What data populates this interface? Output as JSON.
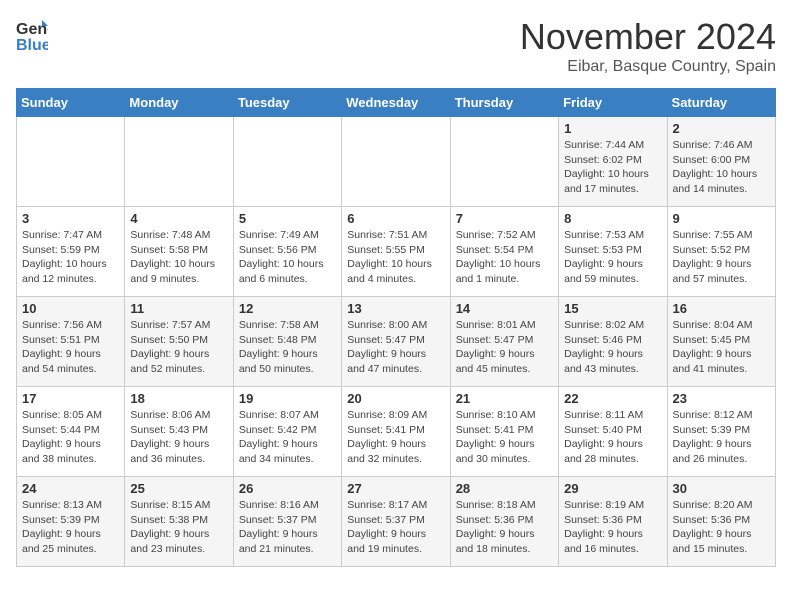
{
  "logo": {
    "general": "General",
    "blue": "Blue"
  },
  "title": "November 2024",
  "location": "Eibar, Basque Country, Spain",
  "days_header": [
    "Sunday",
    "Monday",
    "Tuesday",
    "Wednesday",
    "Thursday",
    "Friday",
    "Saturday"
  ],
  "weeks": [
    [
      {
        "day": "",
        "info": ""
      },
      {
        "day": "",
        "info": ""
      },
      {
        "day": "",
        "info": ""
      },
      {
        "day": "",
        "info": ""
      },
      {
        "day": "",
        "info": ""
      },
      {
        "day": "1",
        "info": "Sunrise: 7:44 AM\nSunset: 6:02 PM\nDaylight: 10 hours and 17 minutes."
      },
      {
        "day": "2",
        "info": "Sunrise: 7:46 AM\nSunset: 6:00 PM\nDaylight: 10 hours and 14 minutes."
      }
    ],
    [
      {
        "day": "3",
        "info": "Sunrise: 7:47 AM\nSunset: 5:59 PM\nDaylight: 10 hours and 12 minutes."
      },
      {
        "day": "4",
        "info": "Sunrise: 7:48 AM\nSunset: 5:58 PM\nDaylight: 10 hours and 9 minutes."
      },
      {
        "day": "5",
        "info": "Sunrise: 7:49 AM\nSunset: 5:56 PM\nDaylight: 10 hours and 6 minutes."
      },
      {
        "day": "6",
        "info": "Sunrise: 7:51 AM\nSunset: 5:55 PM\nDaylight: 10 hours and 4 minutes."
      },
      {
        "day": "7",
        "info": "Sunrise: 7:52 AM\nSunset: 5:54 PM\nDaylight: 10 hours and 1 minute."
      },
      {
        "day": "8",
        "info": "Sunrise: 7:53 AM\nSunset: 5:53 PM\nDaylight: 9 hours and 59 minutes."
      },
      {
        "day": "9",
        "info": "Sunrise: 7:55 AM\nSunset: 5:52 PM\nDaylight: 9 hours and 57 minutes."
      }
    ],
    [
      {
        "day": "10",
        "info": "Sunrise: 7:56 AM\nSunset: 5:51 PM\nDaylight: 9 hours and 54 minutes."
      },
      {
        "day": "11",
        "info": "Sunrise: 7:57 AM\nSunset: 5:50 PM\nDaylight: 9 hours and 52 minutes."
      },
      {
        "day": "12",
        "info": "Sunrise: 7:58 AM\nSunset: 5:48 PM\nDaylight: 9 hours and 50 minutes."
      },
      {
        "day": "13",
        "info": "Sunrise: 8:00 AM\nSunset: 5:47 PM\nDaylight: 9 hours and 47 minutes."
      },
      {
        "day": "14",
        "info": "Sunrise: 8:01 AM\nSunset: 5:47 PM\nDaylight: 9 hours and 45 minutes."
      },
      {
        "day": "15",
        "info": "Sunrise: 8:02 AM\nSunset: 5:46 PM\nDaylight: 9 hours and 43 minutes."
      },
      {
        "day": "16",
        "info": "Sunrise: 8:04 AM\nSunset: 5:45 PM\nDaylight: 9 hours and 41 minutes."
      }
    ],
    [
      {
        "day": "17",
        "info": "Sunrise: 8:05 AM\nSunset: 5:44 PM\nDaylight: 9 hours and 38 minutes."
      },
      {
        "day": "18",
        "info": "Sunrise: 8:06 AM\nSunset: 5:43 PM\nDaylight: 9 hours and 36 minutes."
      },
      {
        "day": "19",
        "info": "Sunrise: 8:07 AM\nSunset: 5:42 PM\nDaylight: 9 hours and 34 minutes."
      },
      {
        "day": "20",
        "info": "Sunrise: 8:09 AM\nSunset: 5:41 PM\nDaylight: 9 hours and 32 minutes."
      },
      {
        "day": "21",
        "info": "Sunrise: 8:10 AM\nSunset: 5:41 PM\nDaylight: 9 hours and 30 minutes."
      },
      {
        "day": "22",
        "info": "Sunrise: 8:11 AM\nSunset: 5:40 PM\nDaylight: 9 hours and 28 minutes."
      },
      {
        "day": "23",
        "info": "Sunrise: 8:12 AM\nSunset: 5:39 PM\nDaylight: 9 hours and 26 minutes."
      }
    ],
    [
      {
        "day": "24",
        "info": "Sunrise: 8:13 AM\nSunset: 5:39 PM\nDaylight: 9 hours and 25 minutes."
      },
      {
        "day": "25",
        "info": "Sunrise: 8:15 AM\nSunset: 5:38 PM\nDaylight: 9 hours and 23 minutes."
      },
      {
        "day": "26",
        "info": "Sunrise: 8:16 AM\nSunset: 5:37 PM\nDaylight: 9 hours and 21 minutes."
      },
      {
        "day": "27",
        "info": "Sunrise: 8:17 AM\nSunset: 5:37 PM\nDaylight: 9 hours and 19 minutes."
      },
      {
        "day": "28",
        "info": "Sunrise: 8:18 AM\nSunset: 5:36 PM\nDaylight: 9 hours and 18 minutes."
      },
      {
        "day": "29",
        "info": "Sunrise: 8:19 AM\nSunset: 5:36 PM\nDaylight: 9 hours and 16 minutes."
      },
      {
        "day": "30",
        "info": "Sunrise: 8:20 AM\nSunset: 5:36 PM\nDaylight: 9 hours and 15 minutes."
      }
    ]
  ]
}
